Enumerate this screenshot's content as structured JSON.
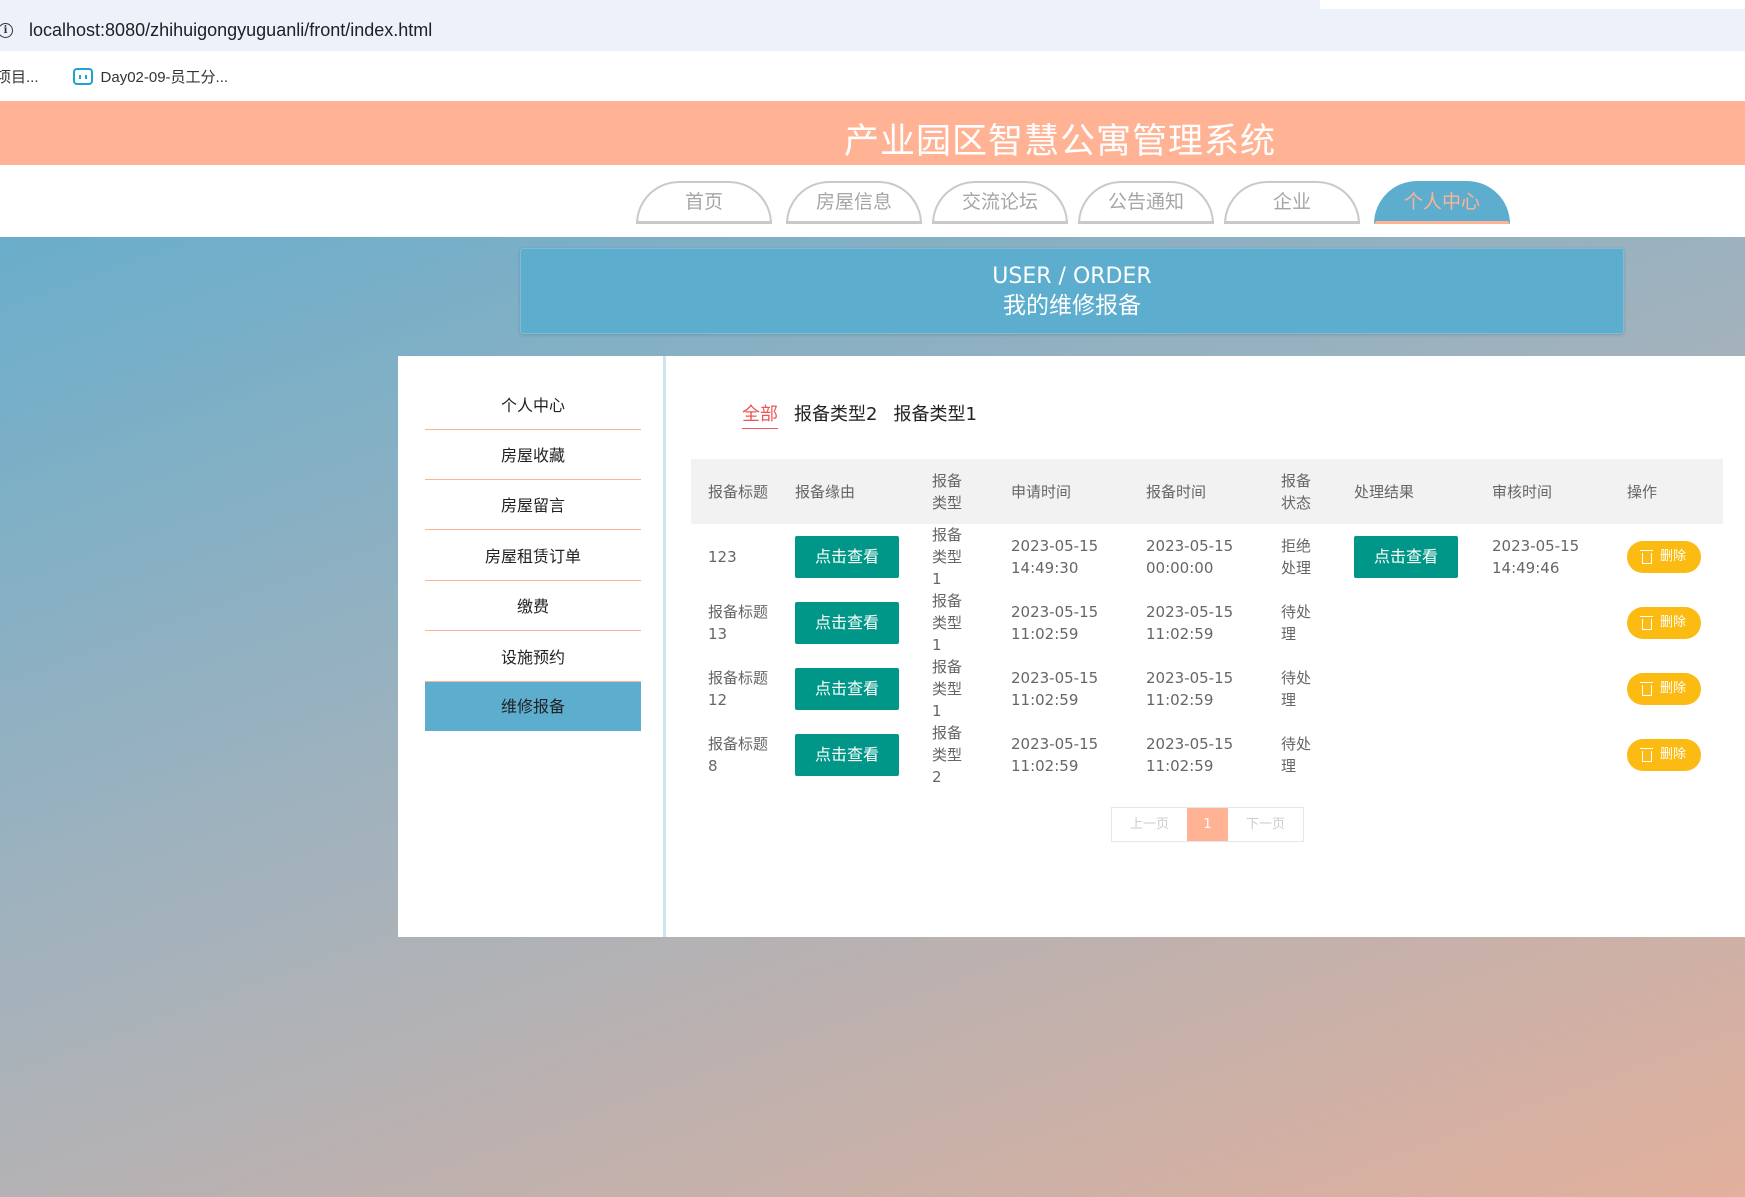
{
  "browser": {
    "url": "localhost:8080/zhihuigongyuguanli/front/index.html",
    "bookmarks": [
      "项目...",
      "Day02-09-员工分..."
    ]
  },
  "site": {
    "title": "产业园区智慧公寓管理系统"
  },
  "nav": [
    "首页",
    "房屋信息",
    "交流论坛",
    "公告通知",
    "企业",
    "个人中心"
  ],
  "banner": {
    "en": "USER / ORDER",
    "cn": "我的维修报备"
  },
  "sidebar": [
    "个人中心",
    "房屋收藏",
    "房屋留言",
    "房屋租赁订单",
    "缴费",
    "设施预约",
    "维修报备"
  ],
  "filters": [
    "全部",
    "报备类型2",
    "报备类型1"
  ],
  "table": {
    "headers": [
      "报备标题",
      "报备缘由",
      "报备类型",
      "申请时间",
      "报备时间",
      "报备状态",
      "处理结果",
      "审核时间",
      "操作"
    ],
    "view_label": "点击查看",
    "delete_label": "删除",
    "rows": [
      {
        "title": "123",
        "type": "报备类型1",
        "apply": "2023-05-15 14:49:30",
        "report": "2023-05-15 00:00:00",
        "status": "拒绝处理",
        "result": "点击查看",
        "audit": "2023-05-15 14:49:46"
      },
      {
        "title": "报备标题13",
        "type": "报备类型1",
        "apply": "2023-05-15 11:02:59",
        "report": "2023-05-15 11:02:59",
        "status": "待处理",
        "result": "",
        "audit": ""
      },
      {
        "title": "报备标题12",
        "type": "报备类型1",
        "apply": "2023-05-15 11:02:59",
        "report": "2023-05-15 11:02:59",
        "status": "待处理",
        "result": "",
        "audit": ""
      },
      {
        "title": "报备标题8",
        "type": "报备类型2",
        "apply": "2023-05-15 11:02:59",
        "report": "2023-05-15 11:02:59",
        "status": "待处理",
        "result": "",
        "audit": ""
      }
    ]
  },
  "pager": {
    "prev": "上一页",
    "current": "1",
    "next": "下一页"
  }
}
